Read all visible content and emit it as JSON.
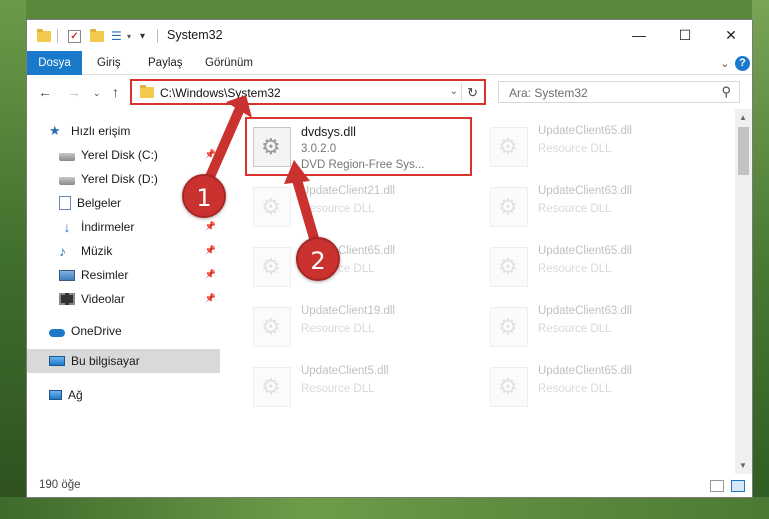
{
  "window": {
    "title": "System32",
    "controls": {
      "minimize": "—",
      "maximize": "☐",
      "close": "✕"
    }
  },
  "ribbon": {
    "tabs": [
      {
        "label": "Dosya"
      },
      {
        "label": "Giriş"
      },
      {
        "label": "Paylaş"
      },
      {
        "label": "Görünüm"
      }
    ],
    "help": "?"
  },
  "nav": {
    "address": "C:\\Windows\\System32",
    "search_placeholder": "Ara: System32"
  },
  "sidebar": {
    "items": [
      {
        "label": "Hızlı erişim",
        "icon": "star-icon"
      },
      {
        "label": "Yerel Disk (C:)",
        "icon": "drive-icon"
      },
      {
        "label": "Yerel Disk (D:)",
        "icon": "drive-icon"
      },
      {
        "label": "Belgeler",
        "icon": "documents-icon"
      },
      {
        "label": "İndirmeler",
        "icon": "downloads-icon"
      },
      {
        "label": "Müzik",
        "icon": "music-icon"
      },
      {
        "label": "Resimler",
        "icon": "pictures-icon"
      },
      {
        "label": "Videolar",
        "icon": "videos-icon"
      },
      {
        "label": "OneDrive",
        "icon": "cloud-icon"
      },
      {
        "label": "Bu bilgisayar",
        "icon": "computer-icon"
      },
      {
        "label": "Ağ",
        "icon": "network-icon"
      }
    ]
  },
  "files": {
    "highlighted": {
      "name": "dvdsys.dll",
      "version": "3.0.2.0",
      "description": "DVD Region-Free Sys..."
    },
    "faded": [
      {
        "name": "UpdateClient65.dll",
        "desc": "Resource DLL"
      },
      {
        "name": "UpdateClient21.dll",
        "desc": "Resource DLL"
      },
      {
        "name": "UpdateClient63.dll",
        "desc": "Resource DLL"
      },
      {
        "name": "UpdateClient65.dll",
        "desc": "Resource DLL"
      },
      {
        "name": "UpdateClient65.dll",
        "desc": "Resource DLL"
      },
      {
        "name": "UpdateClient19.dll",
        "desc": "Resource DLL"
      },
      {
        "name": "UpdateClient63.dll",
        "desc": "Resource DLL"
      },
      {
        "name": "UpdateClient5.dll",
        "desc": "Resource DLL"
      },
      {
        "name": "UpdateClient65.dll",
        "desc": "Resource DLL"
      }
    ]
  },
  "status": {
    "count": "190 öğe"
  },
  "annotations": {
    "step1": "1",
    "step2": "2",
    "accent": "#c9322f"
  }
}
